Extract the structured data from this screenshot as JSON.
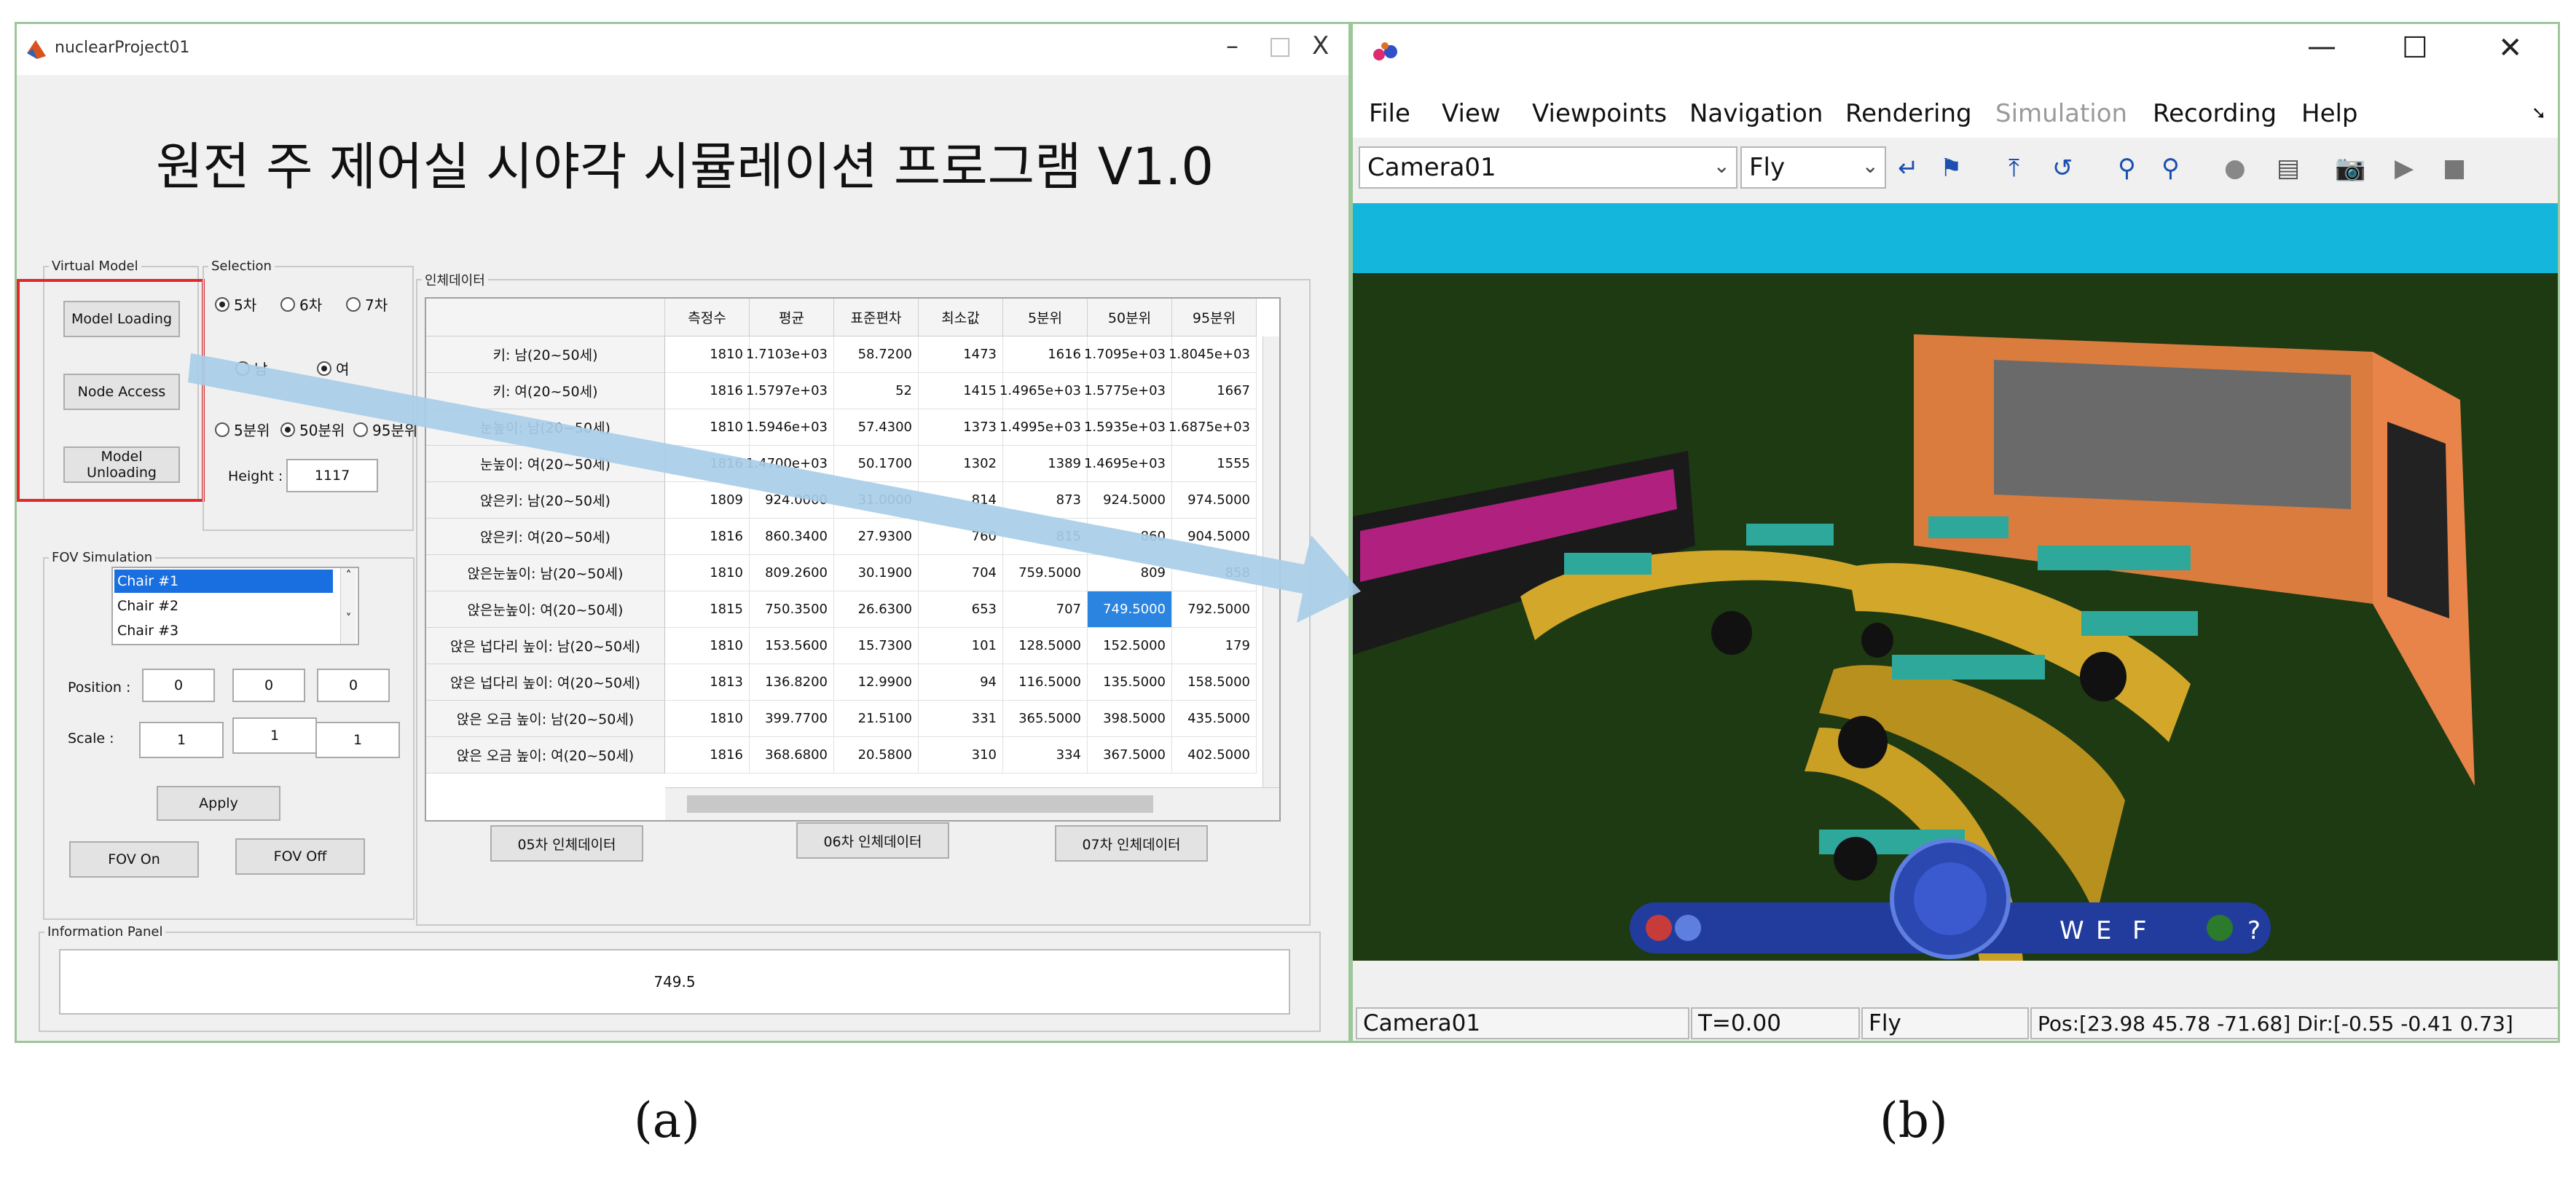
{
  "left_window": {
    "title": "nuclearProject01",
    "controls": {
      "minimize": "–",
      "maximize": "□",
      "close": "X"
    },
    "heading": "원전 주 제어실 시야각 시뮬레이션 프로그램 V1.0",
    "virtual_model": {
      "legend": "Virtual Model",
      "buttons": [
        "Model Loading",
        "Node Access",
        "Model Unloading"
      ]
    },
    "selection": {
      "legend": "Selection",
      "radios_series": [
        "5차",
        "6차",
        "7차"
      ],
      "radios_gender": [
        "남",
        "여"
      ],
      "radios_pct": [
        "5분위",
        "50분위",
        "95분위"
      ],
      "height_label": "Height :",
      "height_value": "1117"
    },
    "fov_simulation": {
      "legend": "FOV Simulation",
      "chairs": [
        "Chair #1",
        "Chair #2",
        "Chair #3"
      ],
      "position_label": "Position :",
      "position": [
        "0",
        "0",
        "0"
      ],
      "scale_label": "Scale :",
      "scale": [
        "1",
        "1",
        "1"
      ],
      "apply": "Apply",
      "fov_on": "FOV On",
      "fov_off": "FOV Off"
    },
    "anthro": {
      "legend": "인체데이터",
      "columns": [
        "측정수",
        "평균",
        "표준편차",
        "최소값",
        "5분위",
        "50분위",
        "95분위"
      ],
      "rows": [
        {
          "label": "키: 남(20~50세)",
          "values": [
            "1810",
            "1.7103e+03",
            "58.7200",
            "1473",
            "1616",
            "1.7095e+03",
            "1.8045e+03"
          ]
        },
        {
          "label": "키: 여(20~50세)",
          "values": [
            "1816",
            "1.5797e+03",
            "52",
            "1415",
            "1.4965e+03",
            "1.5775e+03",
            "1667"
          ]
        },
        {
          "label": "눈높이: 남(20~50세)",
          "values": [
            "1810",
            "1.5946e+03",
            "57.4300",
            "1373",
            "1.4995e+03",
            "1.5935e+03",
            "1.6875e+03"
          ]
        },
        {
          "label": "눈높이: 여(20~50세)",
          "values": [
            "1816",
            "1.4700e+03",
            "50.1700",
            "1302",
            "1389",
            "1.4695e+03",
            "1555"
          ]
        },
        {
          "label": "앉은키: 남(20~50세)",
          "values": [
            "1809",
            "924.0000",
            "31.0000",
            "814",
            "873",
            "924.5000",
            "974.5000"
          ]
        },
        {
          "label": "앉은키: 여(20~50세)",
          "values": [
            "1816",
            "860.3400",
            "27.9300",
            "760",
            "815",
            "860",
            "904.5000"
          ]
        },
        {
          "label": "앉은눈높이: 남(20~50세)",
          "values": [
            "1810",
            "809.2600",
            "30.1900",
            "704",
            "759.5000",
            "809",
            "858"
          ]
        },
        {
          "label": "앉은눈높이: 여(20~50세)",
          "values": [
            "1815",
            "750.3500",
            "26.6300",
            "653",
            "707",
            "749.5000",
            "792.5000"
          ]
        },
        {
          "label": "앉은 넙다리 높이: 남(20~50세)",
          "values": [
            "1810",
            "153.5600",
            "15.7300",
            "101",
            "128.5000",
            "152.5000",
            "179"
          ]
        },
        {
          "label": "앉은 넙다리 높이: 여(20~50세)",
          "values": [
            "1813",
            "136.8200",
            "12.9900",
            "94",
            "116.5000",
            "135.5000",
            "158.5000"
          ]
        },
        {
          "label": "앉은 오금 높이: 남(20~50세)",
          "values": [
            "1810",
            "399.7700",
            "21.5100",
            "331",
            "365.5000",
            "398.5000",
            "435.5000"
          ]
        },
        {
          "label": "앉은 오금 높이: 여(20~50세)",
          "values": [
            "1816",
            "368.6800",
            "20.5800",
            "310",
            "334",
            "367.5000",
            "402.5000"
          ]
        }
      ],
      "buttons": [
        "05차 인체데이터",
        "06차 인체데이터",
        "07차 인체데이터"
      ]
    },
    "info_panel": {
      "legend": "Information Panel",
      "value": "749.5"
    }
  },
  "right_window": {
    "controls": {
      "minimize": "—",
      "maximize": "☐",
      "close": "✕"
    },
    "menus": [
      "File",
      "View",
      "Viewpoints",
      "Navigation",
      "Rendering",
      "Simulation",
      "Recording",
      "Help"
    ],
    "camera_select": "Camera01",
    "mode_select": "Fly",
    "nav_labels": {
      "w": "W",
      "e": "E",
      "f": "F",
      "help": "?"
    },
    "status": {
      "camera": "Camera01",
      "time": "T=0.00",
      "mode": "Fly",
      "pos": "Pos:[23.98 45.78 -71.68] Dir:[-0.55 -0.41 0.73]"
    },
    "colors": {
      "sky": "#14b6dc",
      "ground": "#1e3a12",
      "desk": "#d3a82a",
      "wall": "#e8844a"
    }
  },
  "captions": {
    "a": "(a)",
    "b": "(b)"
  }
}
